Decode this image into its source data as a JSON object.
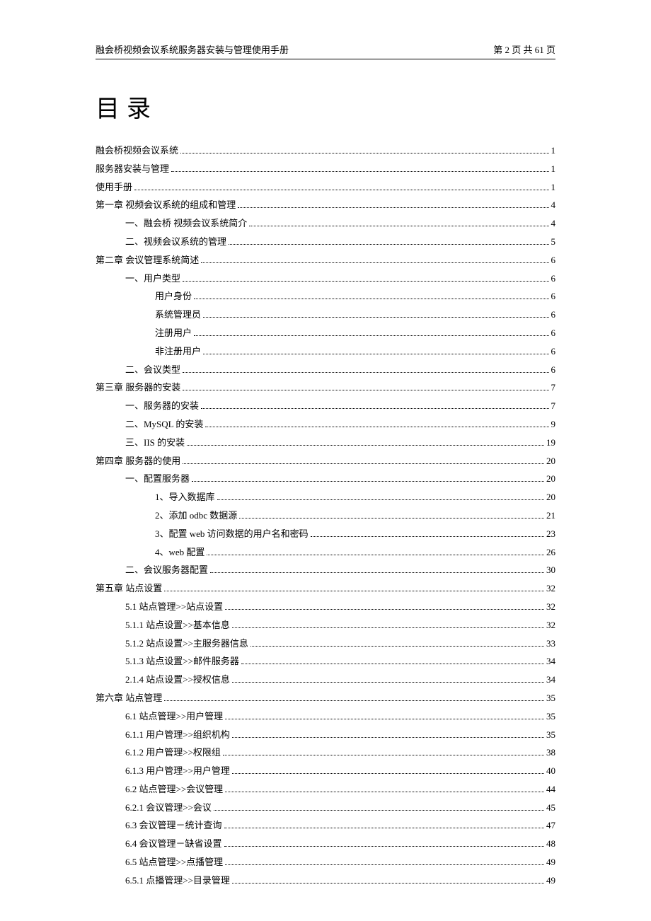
{
  "header": {
    "left": "融会桥视频会议系统服务器安装与管理使用手册",
    "right": "第 2 页 共 61 页"
  },
  "title": "目录",
  "toc": [
    {
      "level": 0,
      "label": "融会桥视频会议系统",
      "page": "1"
    },
    {
      "level": 0,
      "label": "服务器安装与管理",
      "page": "1"
    },
    {
      "level": 0,
      "label": "使用手册",
      "page": "1"
    },
    {
      "level": 0,
      "label": "第一章   视频会议系统的组成和管理",
      "page": "4"
    },
    {
      "level": 1,
      "label": "一、融会桥 视频会议系统简介",
      "page": "4"
    },
    {
      "level": 1,
      "label": "二、视频会议系统的管理",
      "page": "5"
    },
    {
      "level": 0,
      "label": "第二章   会议管理系统简述",
      "page": "6"
    },
    {
      "level": 1,
      "label": "一、用户类型",
      "page": "6"
    },
    {
      "level": 2,
      "label": "用户身份",
      "page": "6"
    },
    {
      "level": 2,
      "label": "系统管理员",
      "page": "6"
    },
    {
      "level": 2,
      "label": "注册用户",
      "page": "6"
    },
    {
      "level": 2,
      "label": "非注册用户",
      "page": "6"
    },
    {
      "level": 1,
      "label": "二、会议类型",
      "page": "6"
    },
    {
      "level": 0,
      "label": "第三章   服务器的安装",
      "page": "7"
    },
    {
      "level": 1,
      "label": "一、服务器的安装",
      "page": "7"
    },
    {
      "level": 1,
      "label": "二、MySQL 的安装",
      "page": "9"
    },
    {
      "level": 1,
      "label": "三、IIS 的安装",
      "page": "19"
    },
    {
      "level": 0,
      "label": "第四章   服务器的使用",
      "page": "20"
    },
    {
      "level": 1,
      "label": "一、配置服务器",
      "page": "20"
    },
    {
      "level": 2,
      "label": "1、导入数据库",
      "page": "20"
    },
    {
      "level": 2,
      "label": "2、添加 odbc 数据源",
      "page": "21"
    },
    {
      "level": 2,
      "label": "3、配置 web 访问数据的用户名和密码",
      "page": "23"
    },
    {
      "level": 2,
      "label": "4、web 配置",
      "page": "26"
    },
    {
      "level": 1,
      "label": "二、会议服务器配置",
      "page": "30"
    },
    {
      "level": 0,
      "label": "第五章 站点设置",
      "page": "32"
    },
    {
      "level": 1,
      "label": "5.1 站点管理>>站点设置",
      "page": "32"
    },
    {
      "level": 1,
      "label": "5.1.1 站点设置>>基本信息",
      "page": "32"
    },
    {
      "level": 1,
      "label": "5.1.2 站点设置>>主服务器信息",
      "page": "33"
    },
    {
      "level": 1,
      "label": "5.1.3 站点设置>>邮件服务器",
      "page": "34"
    },
    {
      "level": 1,
      "label": "2.1.4 站点设置>>授权信息",
      "page": "34"
    },
    {
      "level": 0,
      "label": "第六章   站点管理",
      "page": "35"
    },
    {
      "level": 1,
      "label": "6.1 站点管理>>用户管理",
      "page": "35"
    },
    {
      "level": 1,
      "label": "6.1.1 用户管理>>组织机构",
      "page": "35"
    },
    {
      "level": 1,
      "label": "6.1.2 用户管理>>权限组",
      "page": "38"
    },
    {
      "level": 1,
      "label": "6.1.3 用户管理>>用户管理",
      "page": "40"
    },
    {
      "level": 1,
      "label": "6.2 站点管理>>会议管理",
      "page": "44"
    },
    {
      "level": 1,
      "label": "6.2.1 会议管理>>会议",
      "page": "45"
    },
    {
      "level": 1,
      "label": "6.3 会议管理－统计查询",
      "page": "47"
    },
    {
      "level": 1,
      "label": "6.4 会议管理－缺省设置",
      "page": "48"
    },
    {
      "level": 1,
      "label": "6.5 站点管理>>点播管理",
      "page": "49"
    },
    {
      "level": 1,
      "label": "6.5.1 点播管理>>目录管理",
      "page": "49"
    }
  ]
}
